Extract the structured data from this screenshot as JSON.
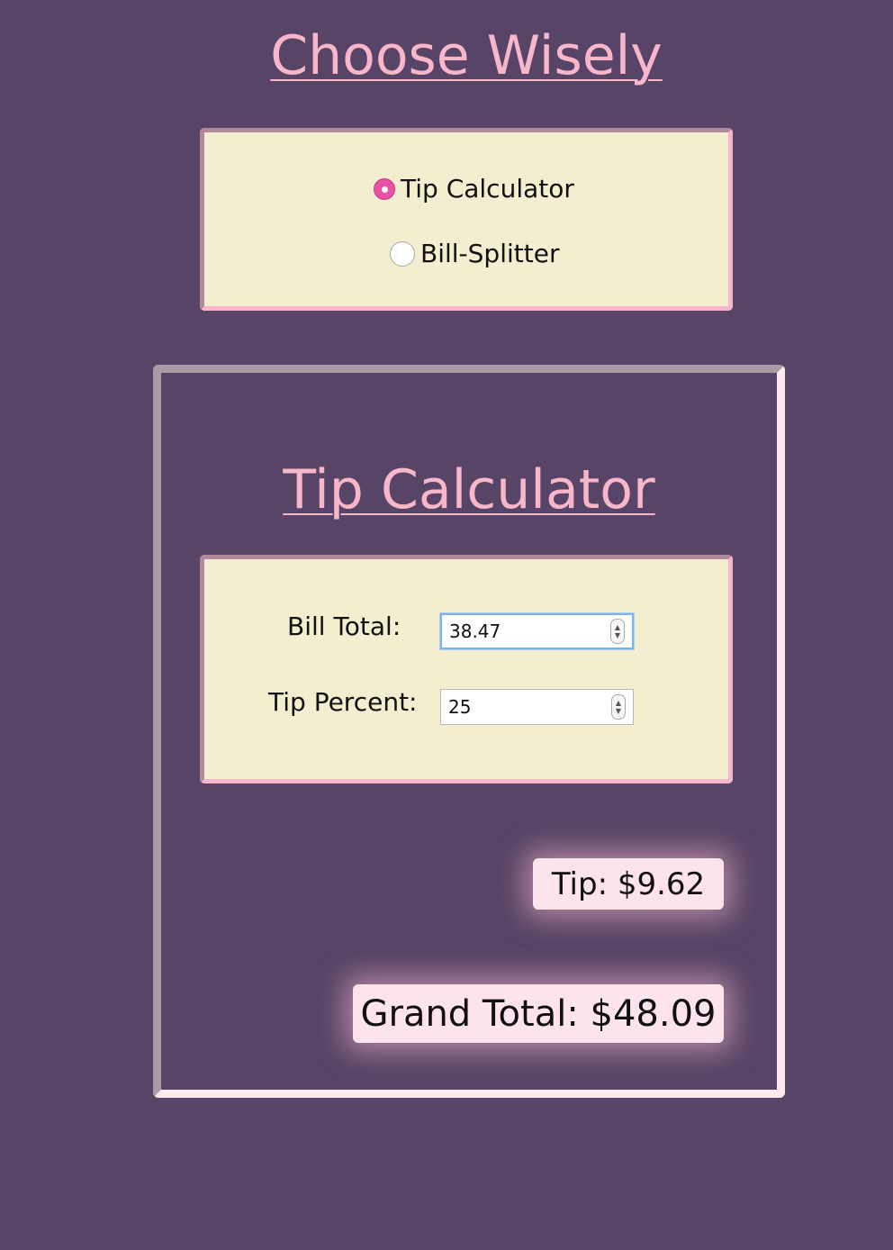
{
  "header": {
    "title": "Choose Wisely"
  },
  "chooser": {
    "options": [
      {
        "label": "Tip Calculator",
        "selected": true
      },
      {
        "label": "Bill-Splitter",
        "selected": false
      }
    ]
  },
  "calculator": {
    "title": "Tip Calculator",
    "bill_total_label": "Bill Total:",
    "bill_total_value": "38.47",
    "tip_percent_label": "Tip Percent:",
    "tip_percent_value": "25",
    "tip_result": "Tip: $9.62",
    "grand_total_result": "Grand Total: $48.09"
  },
  "colors": {
    "background": "#574466",
    "accent_pink": "#f7b6c9",
    "panel_cream": "#f3eed0",
    "radio_selected": "#e751a6"
  }
}
